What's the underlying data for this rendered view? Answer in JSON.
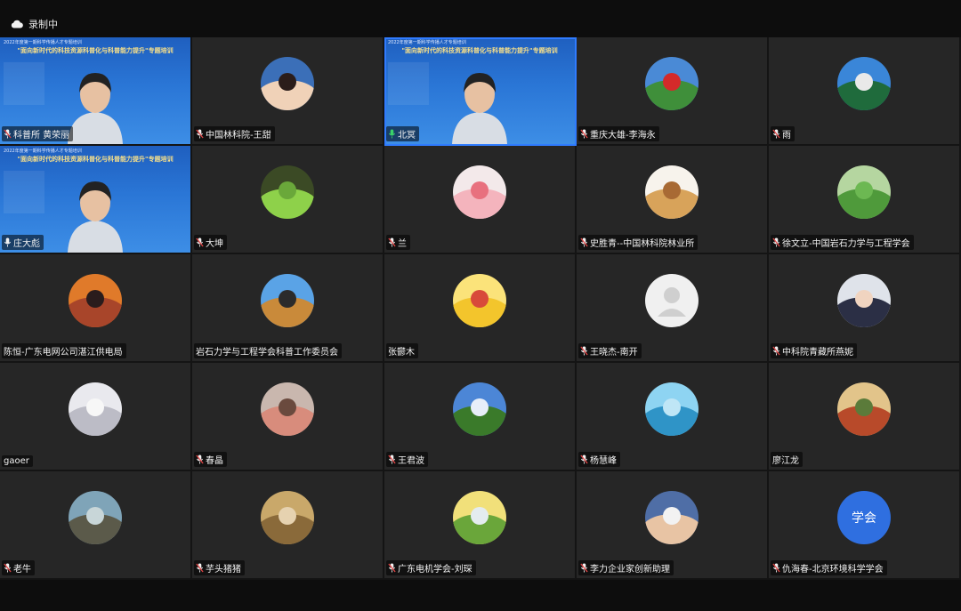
{
  "status": {
    "recording_label": "录制中"
  },
  "banner": {
    "title": "\"面向新时代的科技资源科普化与科普能力提升\"专题培训",
    "subtitle": "2022年度第一期科学传播人才专题培训"
  },
  "colors": {
    "tile_bg": "#262626",
    "video_bg": "#2a76d6",
    "active_border": "#2f7bff",
    "text_avatar": "#2f6fe0"
  },
  "participants": [
    {
      "name": "科普所 黄荣丽",
      "mic": "muted",
      "type": "video",
      "icon": "host-icon"
    },
    {
      "name": "中国林科院-王甜",
      "mic": "muted",
      "type": "avatar",
      "icon": "anime-girl-avatar"
    },
    {
      "name": "北冥",
      "mic": "active",
      "type": "video",
      "icon": "speaker-video"
    },
    {
      "name": "重庆大雄-李海永",
      "mic": "muted",
      "type": "avatar",
      "icon": "landscape-flowers-avatar"
    },
    {
      "name": "雨",
      "mic": "muted",
      "type": "avatar",
      "icon": "palm-tree-avatar"
    },
    {
      "name": "庄大彪",
      "mic": "unmuted",
      "type": "video",
      "icon": "woman-video"
    },
    {
      "name": "大坤",
      "mic": "muted",
      "type": "avatar",
      "icon": "sprout-avatar"
    },
    {
      "name": "兰",
      "mic": "muted",
      "type": "avatar",
      "icon": "pink-blob-avatar"
    },
    {
      "name": "史胜青--中国林科院林业所",
      "mic": "muted",
      "type": "avatar",
      "icon": "cartoon-man-hat-avatar"
    },
    {
      "name": "徐文立-中国岩石力学与工程学会",
      "mic": "muted",
      "type": "avatar",
      "icon": "lily-pads-avatar"
    },
    {
      "name": "陈恒-广东电网公司湛江供电局",
      "mic": "none",
      "type": "avatar",
      "icon": "sunset-avatar"
    },
    {
      "name": "岩石力学与工程学会科普工作委员会",
      "mic": "none",
      "type": "avatar",
      "icon": "person-sky-avatar"
    },
    {
      "name": "张鬱木",
      "mic": "none",
      "type": "avatar",
      "icon": "pikachu-avatar"
    },
    {
      "name": "王晓杰-南开",
      "mic": "muted",
      "type": "avatar",
      "icon": "default-user-avatar"
    },
    {
      "name": "中科院青藏所燕妮",
      "mic": "muted",
      "type": "avatar",
      "icon": "anime-boy-avatar"
    },
    {
      "name": "gaoer",
      "mic": "none",
      "type": "avatar",
      "icon": "white-flower-avatar"
    },
    {
      "name": "春晶",
      "mic": "muted",
      "type": "avatar",
      "icon": "girl-painting-avatar"
    },
    {
      "name": "王君波",
      "mic": "muted",
      "type": "avatar",
      "icon": "tree-field-avatar"
    },
    {
      "name": "杨慧峰",
      "mic": "muted",
      "type": "avatar",
      "icon": "sea-avatar"
    },
    {
      "name": "廖江龙",
      "mic": "none",
      "type": "avatar",
      "icon": "autumn-painting-avatar"
    },
    {
      "name": "老牛",
      "mic": "muted",
      "type": "avatar",
      "icon": "rocky-coast-avatar"
    },
    {
      "name": "芋头猪猪",
      "mic": "muted",
      "type": "avatar",
      "icon": "cartoon-character-avatar"
    },
    {
      "name": "广东电机学会-刘琛",
      "mic": "muted",
      "type": "avatar",
      "icon": "power-tower-avatar"
    },
    {
      "name": "李力企业家创新助理",
      "mic": "muted",
      "type": "avatar",
      "icon": "man-portrait-avatar"
    },
    {
      "name": "仇海春-北京环境科学学会",
      "mic": "muted",
      "type": "text",
      "avatar_text": "学会",
      "icon": "text-avatar"
    }
  ]
}
